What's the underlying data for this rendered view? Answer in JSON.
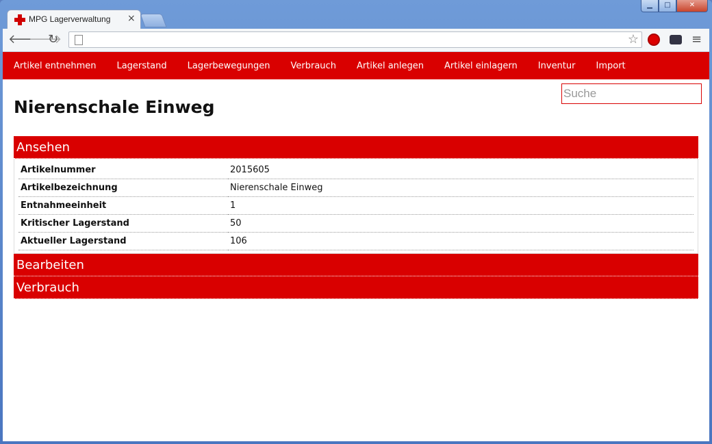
{
  "browser": {
    "tab_title": "MPG Lagerverwaltung",
    "tab_close": "×",
    "url": "",
    "window_controls": {
      "minimize": "▁",
      "maximize": "□",
      "close": "✕"
    }
  },
  "nav": {
    "items": [
      {
        "label": "Artikel entnehmen"
      },
      {
        "label": "Lagerstand"
      },
      {
        "label": "Lagerbewegungen"
      },
      {
        "label": "Verbrauch"
      },
      {
        "label": "Artikel anlegen"
      },
      {
        "label": "Artikel einlagern"
      },
      {
        "label": "Inventur"
      },
      {
        "label": "Import"
      }
    ]
  },
  "search": {
    "placeholder": "Suche"
  },
  "page": {
    "title": "Nierenschale Einweg"
  },
  "panels": {
    "view": {
      "header": "Ansehen",
      "rows": [
        {
          "key": "Artikelnummer",
          "value": "2015605"
        },
        {
          "key": "Artikelbezeichnung",
          "value": "Nierenschale Einweg"
        },
        {
          "key": "Entnahmeeinheit",
          "value": "1"
        },
        {
          "key": "Kritischer Lagerstand",
          "value": "50"
        },
        {
          "key": "Aktueller Lagerstand",
          "value": "106"
        }
      ]
    },
    "edit": {
      "header": "Bearbeiten"
    },
    "usage": {
      "header": "Verbrauch"
    }
  },
  "colors": {
    "accent": "#d90000"
  }
}
